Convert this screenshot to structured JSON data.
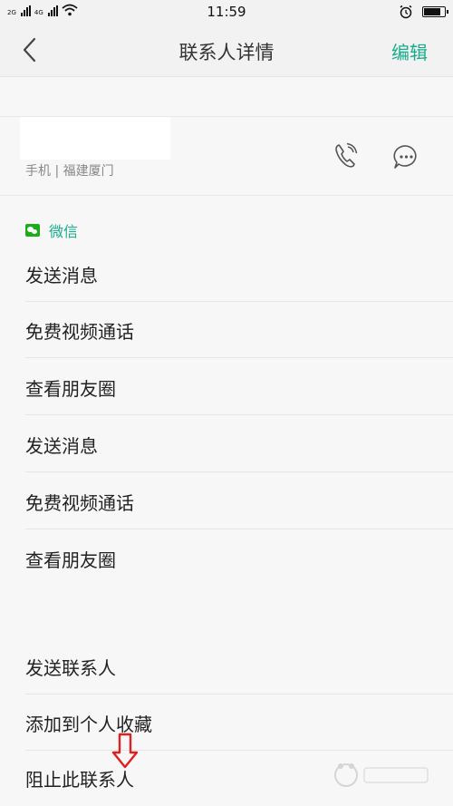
{
  "status_bar": {
    "net1": "2G",
    "net2": "4G",
    "time": "11:59",
    "battery_level": 0.85,
    "icons": [
      "signal-icon",
      "wifi-icon",
      "alarm-icon",
      "battery-icon"
    ]
  },
  "nav": {
    "title": "联系人详情",
    "edit_label": "编辑",
    "back_icon": "chevron-left-icon"
  },
  "contact": {
    "name": "",
    "subtitle": "手机 | 福建厦门",
    "call_icon": "phone-call-icon",
    "message_icon": "chat-bubble-icon"
  },
  "wechat": {
    "title": "微信",
    "items": [
      "发送消息",
      "免费视频通话",
      "查看朋友圈",
      "发送消息",
      "免费视频通话",
      "查看朋友圈"
    ]
  },
  "actions": {
    "items": [
      "发送联系人",
      "添加到个人收藏",
      "阻止此联系人"
    ]
  },
  "colors": {
    "accent": "#1aad8d",
    "wechat_green": "#1aad19",
    "annotation_red": "#e02020"
  }
}
